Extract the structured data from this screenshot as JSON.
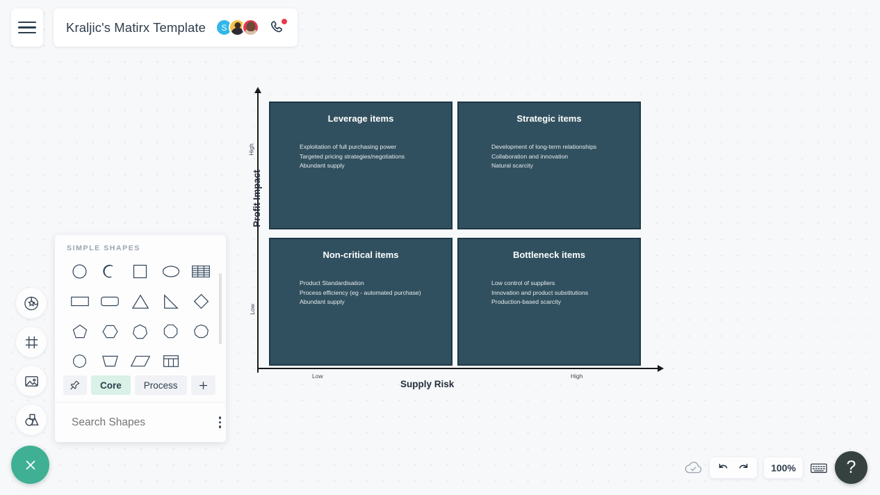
{
  "header": {
    "menu_icon": "hamburger-menu-icon",
    "title": "Kraljic's Matirx Template",
    "avatars": [
      {
        "name": "avatar-initial-s",
        "initial": "S",
        "color": "#31b7e8"
      },
      {
        "name": "avatar-photo-1",
        "initial": "",
        "color": "#f5c245"
      },
      {
        "name": "avatar-photo-2",
        "initial": "",
        "color": "#e8394f"
      }
    ],
    "call_icon": "phone-icon",
    "call_badge": true
  },
  "left_rail": {
    "items": [
      {
        "icon": "sticker-star-icon",
        "label": "Stickers"
      },
      {
        "icon": "frame-icon",
        "label": "Frames"
      },
      {
        "icon": "image-icon",
        "label": "Images"
      },
      {
        "icon": "shapes-icon",
        "label": "Shapes"
      }
    ]
  },
  "shapes_panel": {
    "section_title": "SIMPLE SHAPES",
    "shapes": [
      "circle-shape",
      "arc-shape",
      "square-shape",
      "ellipse-shape",
      "table-rows-shape",
      "rectangle-shape",
      "rounded-rectangle-shape",
      "triangle-shape",
      "right-triangle-shape",
      "diamond-shape",
      "pentagon-shape",
      "hexagon-shape",
      "heptagon-shape",
      "octagon-shape",
      "nonagon-shape",
      "decagon-shape",
      "trapezoid-shape",
      "parallelogram-shape",
      "grid-table-shape"
    ],
    "tabs": [
      {
        "name": "tab-pinned",
        "label": "",
        "icon": "pin-icon",
        "active": false
      },
      {
        "name": "tab-core",
        "label": "Core",
        "icon": "",
        "active": true
      },
      {
        "name": "tab-process",
        "label": "Process",
        "icon": "",
        "active": false
      },
      {
        "name": "tab-add",
        "label": "+",
        "icon": "plus-icon",
        "active": false
      }
    ],
    "search_placeholder": "Search Shapes",
    "search_value": "",
    "search_icon": "search-icon",
    "more_icon": "kebab-menu-icon",
    "active_tab_color": "#d9f1e6"
  },
  "canvas": {
    "close_button_icon": "close-x-icon",
    "close_button_color": "#3fb094"
  },
  "chart_data": {
    "type": "matrix",
    "title": "Kraljic's Matirx Template",
    "xlabel": "Supply Risk",
    "ylabel": "Profit Impact",
    "xticks": [
      "Low",
      "High"
    ],
    "yticks": [
      "High",
      "Low"
    ],
    "grid": false,
    "quadrant_fill": "#31505f",
    "quadrant_border": "#1e3846",
    "quadrants": [
      {
        "position": "top-left",
        "title": "Leverage items",
        "x": "Low Supply Risk",
        "y": "High Profit Impact",
        "bullets": [
          "Exploitation of full purchasing power",
          "Targeted pricing strategies/negotiations",
          "Abundant supply"
        ]
      },
      {
        "position": "top-right",
        "title": "Strategic items",
        "x": "High Supply Risk",
        "y": "High Profit Impact",
        "bullets": [
          "Development of long-term relationships",
          "Collaboration and innovation",
          "Natural scarcity"
        ]
      },
      {
        "position": "bottom-left",
        "title": "Non-critical items",
        "x": "Low Supply Risk",
        "y": "Low Profit Impact",
        "bullets": [
          "Product Standardisation",
          "Process efficiency (eg - automated purchase)",
          "Abundant supply"
        ]
      },
      {
        "position": "bottom-right",
        "title": "Bottleneck items",
        "x": "High Supply Risk",
        "y": "Low Profit Impact",
        "bullets": [
          "Low control of suppliers",
          "Innovation and product substitutions",
          "Production-based scarcity"
        ]
      }
    ]
  },
  "bottom_bar": {
    "save_status_icon": "cloud-check-icon",
    "undo_icon": "undo-arrow-icon",
    "redo_icon": "redo-arrow-icon",
    "zoom_level": "100%",
    "keyboard_icon": "keyboard-icon",
    "help_label": "?"
  }
}
